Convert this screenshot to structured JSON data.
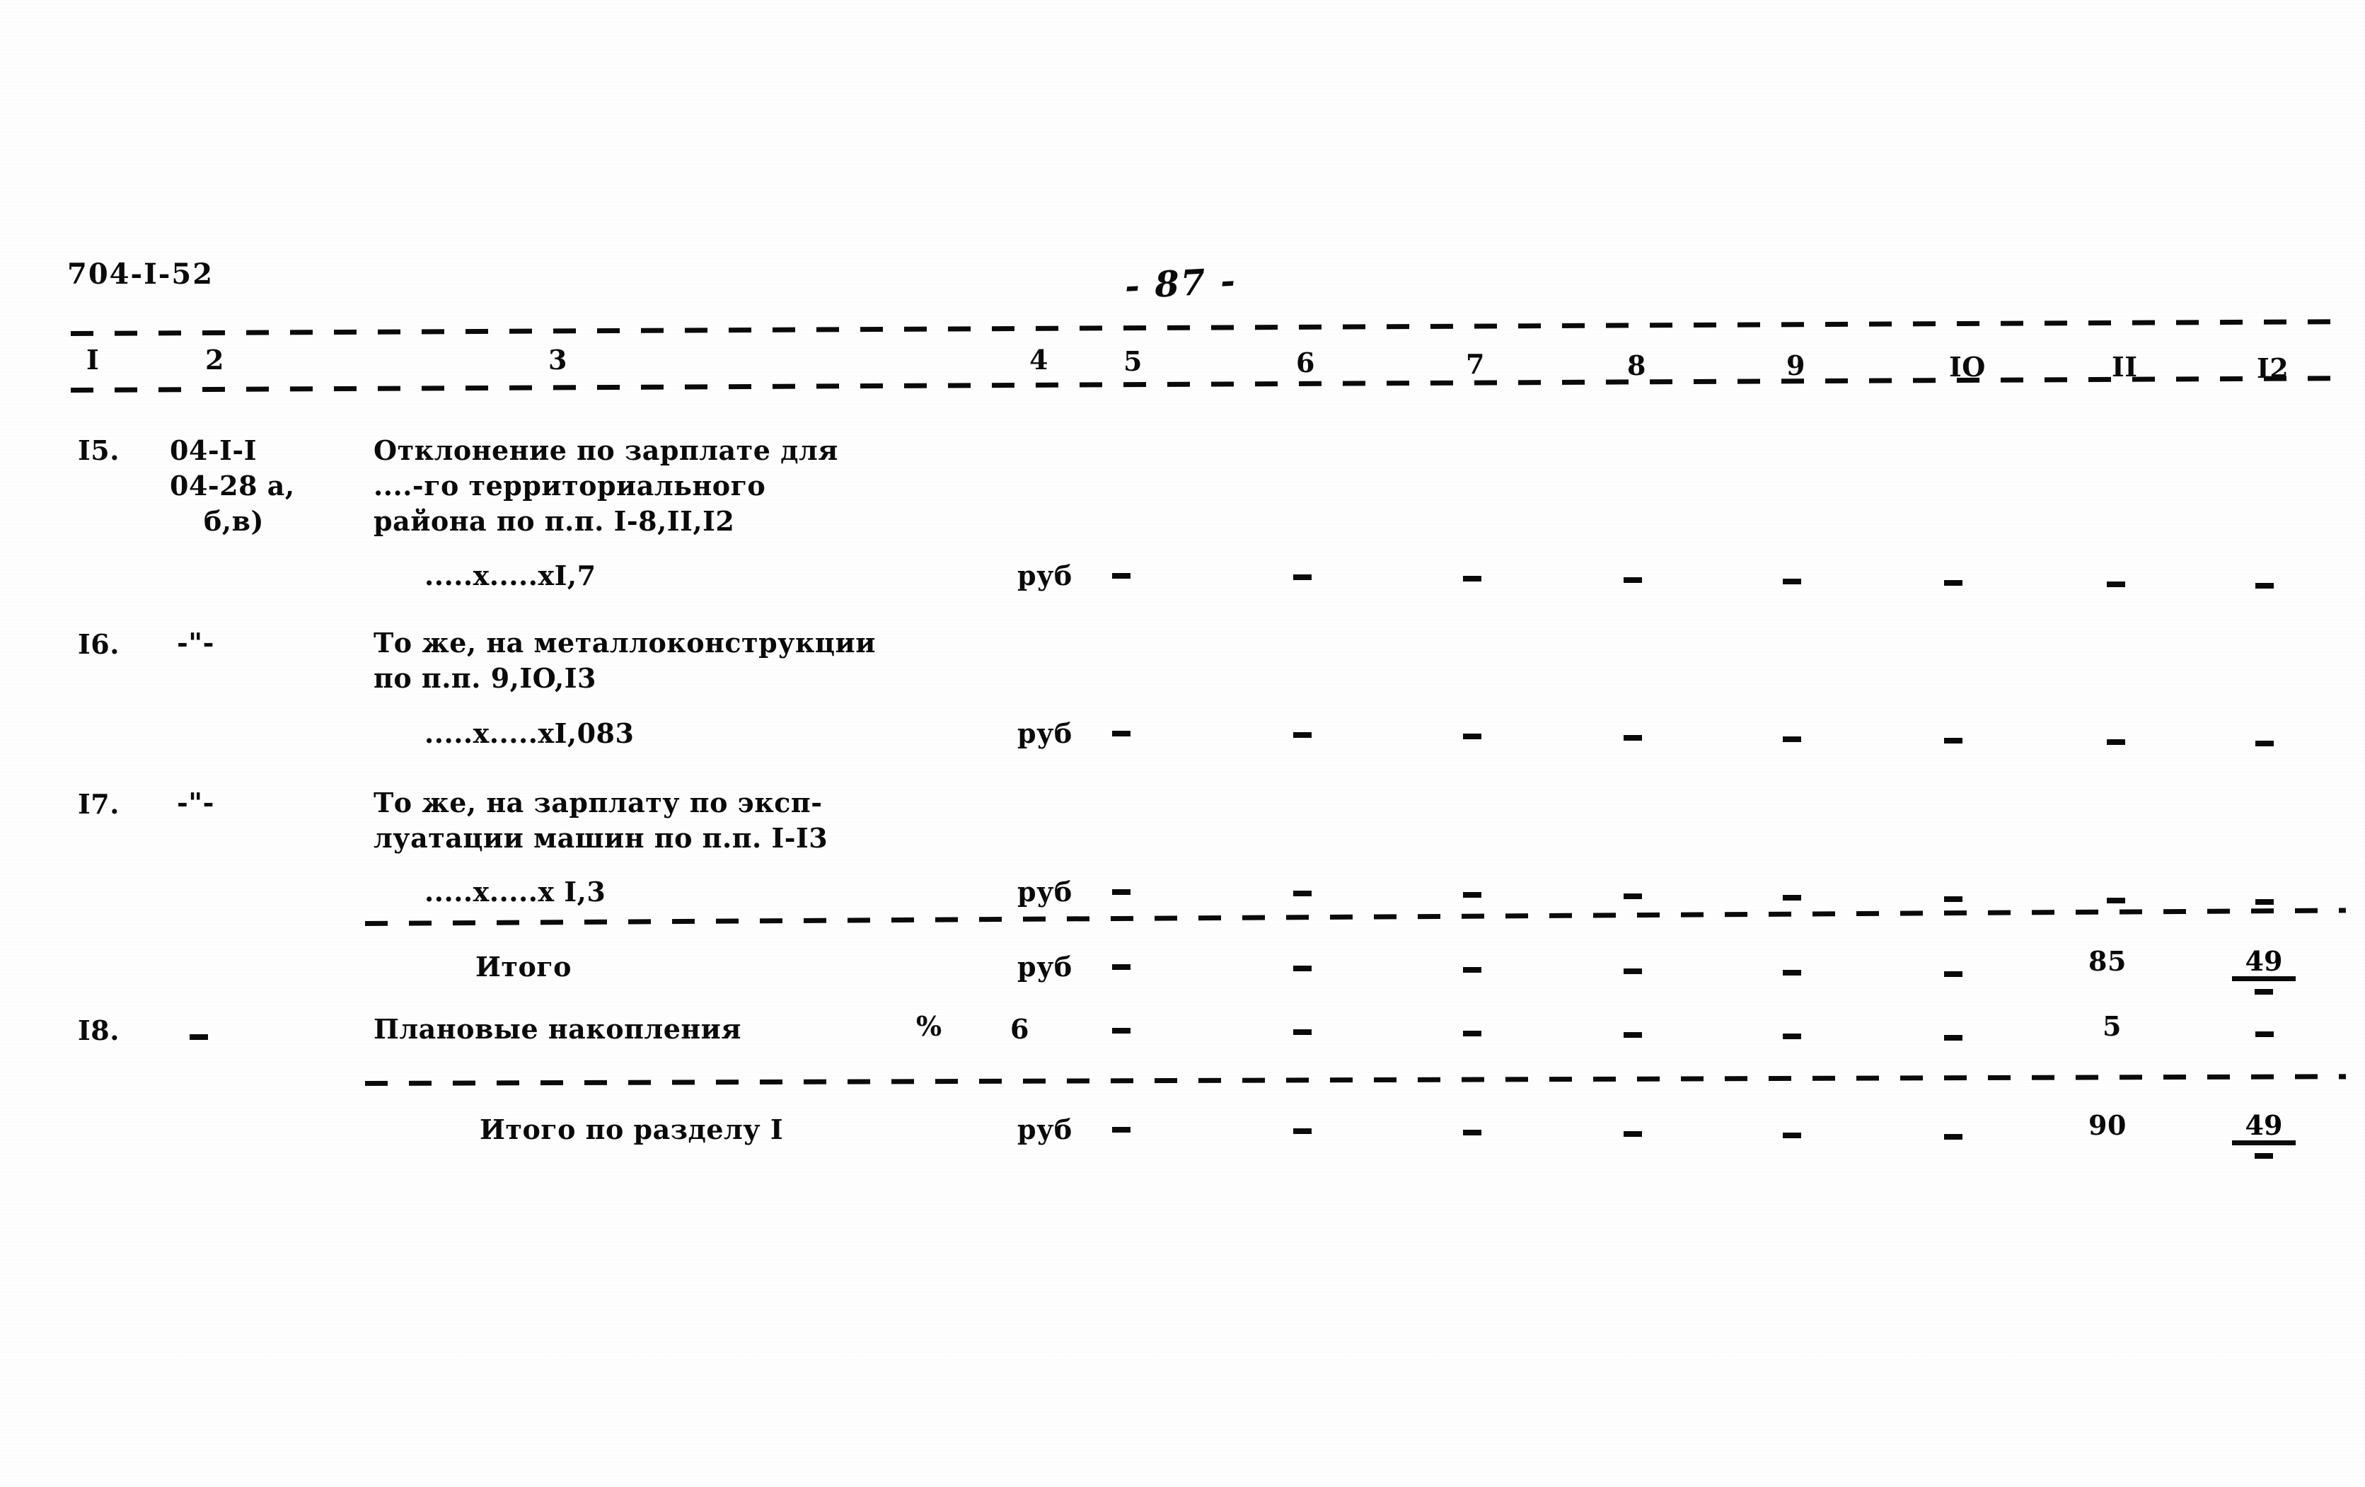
{
  "document": {
    "code": "704-I-52",
    "page_number": "- 87 -"
  },
  "table": {
    "column_headers": [
      "I",
      "2",
      "3",
      "4",
      "5",
      "6",
      "7",
      "8",
      "9",
      "IO",
      "II",
      "I2"
    ],
    "rows": [
      {
        "no": "I5.",
        "code_lines": [
          "04-I-I",
          "04-28 а,",
          "б,в)"
        ],
        "description_lines": [
          "Отклонение по зарплате для",
          "....-го территориального",
          "района по п.п. I-8,II,I2"
        ],
        "formula": ".....х.....хI,7",
        "unit": "руб",
        "values": [
          "–",
          "–",
          "–",
          "–",
          "–",
          "–",
          "–",
          "–"
        ]
      },
      {
        "no": "I6.",
        "code_lines": [
          "-\"-"
        ],
        "description_lines": [
          "То же, на металлоконструкции",
          "по п.п. 9,IO,I3"
        ],
        "formula": ".....х.....хI,083",
        "unit": "руб",
        "values": [
          "–",
          "–",
          "–",
          "–",
          "–",
          "–",
          "–",
          "–"
        ]
      },
      {
        "no": "I7.",
        "code_lines": [
          "-\"-"
        ],
        "description_lines": [
          "То же, на зарплату по эксп-",
          "луатации машин по п.п. I-I3"
        ],
        "formula": ".....х.....х I,3",
        "unit": "руб",
        "values": [
          "–",
          "–",
          "–",
          "–",
          "–",
          "–",
          "–",
          "–"
        ]
      }
    ],
    "subtotal": {
      "label": "Итого",
      "unit": "руб",
      "values": [
        "–",
        "–",
        "–",
        "–",
        "–",
        "–"
      ],
      "col11": "85",
      "col12_num": "49",
      "col12_dash": "–"
    },
    "overhead": {
      "no": "I8.",
      "code": "–",
      "label": "Плановые накопления",
      "unit": "%",
      "rate": "6",
      "values": [
        "–",
        "–",
        "–",
        "–",
        "–",
        "–"
      ],
      "col11": "5",
      "col12": "–"
    },
    "section_total": {
      "label": "Итого по разделу I",
      "unit": "руб",
      "values": [
        "–",
        "–",
        "–",
        "–",
        "–",
        "–"
      ],
      "col11": "90",
      "col12_num": "49",
      "col12_dash": "–"
    }
  }
}
